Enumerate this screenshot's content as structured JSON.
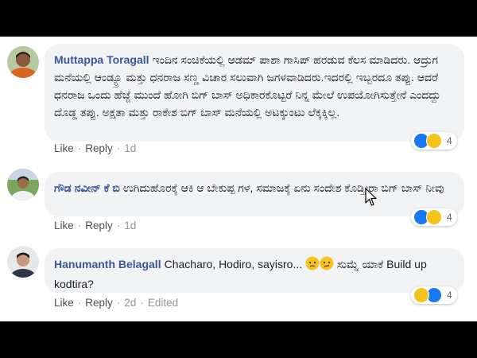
{
  "comments": [
    {
      "author": "Muttappa Toragall",
      "text": "ಇಂದಿನ ಸಂಚಿಕೆಯಲ್ಲಿ ಆಡಮ್ ಪಾಶಾ ಗಾಸಿಪ್ ಹರಡುವ ಕೆಲಸ ಮಾಡಿದರು. ಆದ್ರುಗ ಮನೆಯಲ್ಲಿ ಆಂಡ್ಯ್ರೂ ಮತ್ತು ಧನರಾಜ ಸಣ್ಣ ವಿಚಾರ ಸಲುವಾಗಿ ಜಗಳವಾಡಿದರು.ಇದರಲ್ಲಿ ಇಬ್ಬರದೂ ತಪ್ಪು. ಆದರೆ ಧನರಾಜ ಒಂದು ಹೆಜ್ಜೆ ಮುಂದೆ ಹೋಗಿ ಬಿಗ್ ಬಾಸ್ ಅಧಿಕಾರಕೊಟ್ಟರೆ ನಿನ್ನ ಮೇಲೆ ಉಪಯೋಗಿಸುತ್ತೇನೆ ಎಂದದ್ದು ದೊಡ್ಡ ತಪ್ಪು. ಅಕ್ಷತಾ ಮತ್ತು ರಾಕೇಶ ಬಿಗ್ ಬಾಸ್ ಮನೆಯಲ್ಲಿ ಅಟಕ್ಕುಂಟು ಲೆಕ್ಕಕ್ಕಿಲ್ಲ.",
      "like": "Like",
      "reply": "Reply",
      "time": "1d",
      "reaction_count": "4"
    },
    {
      "author": "ಗೌಡ ನವೀನ್ ಕೆ ಬಿ",
      "text": "ಉಗಿದುಹೊರಕ್ಕೆ ಆಕಿ ಆ ಬೇಕುಪ್ಪ ಗಳ, ಸಮಾಜಕ್ಕೆ ಏನು ಸಂದೇಶ ಕೊಡ್ತೀರಾ ಬಿಗ್ ಬಾಸ್ ನೀವು",
      "like": "Like",
      "reply": "Reply",
      "time": "1d",
      "reaction_count": "4"
    },
    {
      "author": "Hanumanth Belagall",
      "text_part1": "Chacharo, Hodiro, sayisro...",
      "text_part2": "ಸುಮ್ನೆ ಯಾಕೆ Build up kodtira?",
      "like": "Like",
      "reply": "Reply",
      "time": "2d",
      "edited": "Edited",
      "reaction_count": "4"
    }
  ],
  "icons": {
    "like_reaction": "like-reaction-icon",
    "haha_reaction": "haha-reaction-icon",
    "cursor": "mouse-pointer-icon"
  },
  "colors": {
    "author": "#385898",
    "like_blue": "#1877f2",
    "haha_yellow": "#f7c21c",
    "bubble": "#f2f3f5"
  }
}
